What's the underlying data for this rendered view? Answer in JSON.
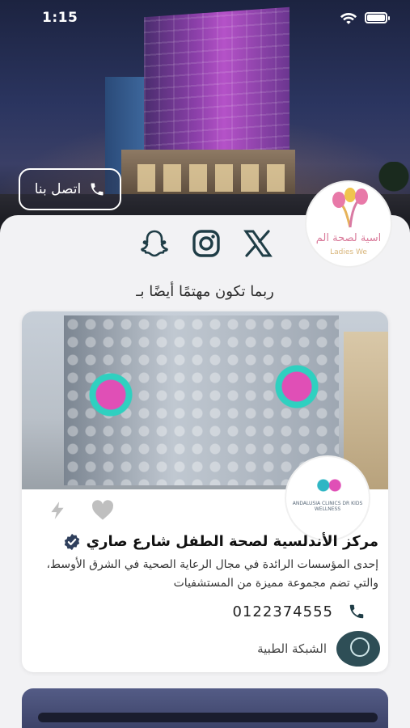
{
  "status_bar": {
    "time": "1:15"
  },
  "hero": {
    "contact_button_label": "اتصل بنا"
  },
  "org_logo": {
    "text": "اسية لصحة الم",
    "sub": "Ladies We"
  },
  "socials": [
    {
      "name": "snapchat-icon"
    },
    {
      "name": "instagram-icon"
    },
    {
      "name": "x-icon"
    }
  ],
  "section_title": "ربما تكون مهتمًا أيضًا بـ",
  "card": {
    "title": "مركز الأندلسية لصحة الطفل  شارع صاري",
    "description": "إحدى المؤسسات الرائدة في مجال الرعاية الصحية في الشرق الأوسط، والتي تضم مجموعة مميزة من المستشفيات",
    "phone": "0122374555",
    "network_name": "الشبكة الطبية",
    "logo_caption": "ANDALUSIA CLINICS DR KIDS WELLNESS"
  },
  "colors": {
    "icon_dark": "#1f3d46",
    "verified": "#2f3f5c",
    "disabled_icon": "#bfbfbf"
  }
}
